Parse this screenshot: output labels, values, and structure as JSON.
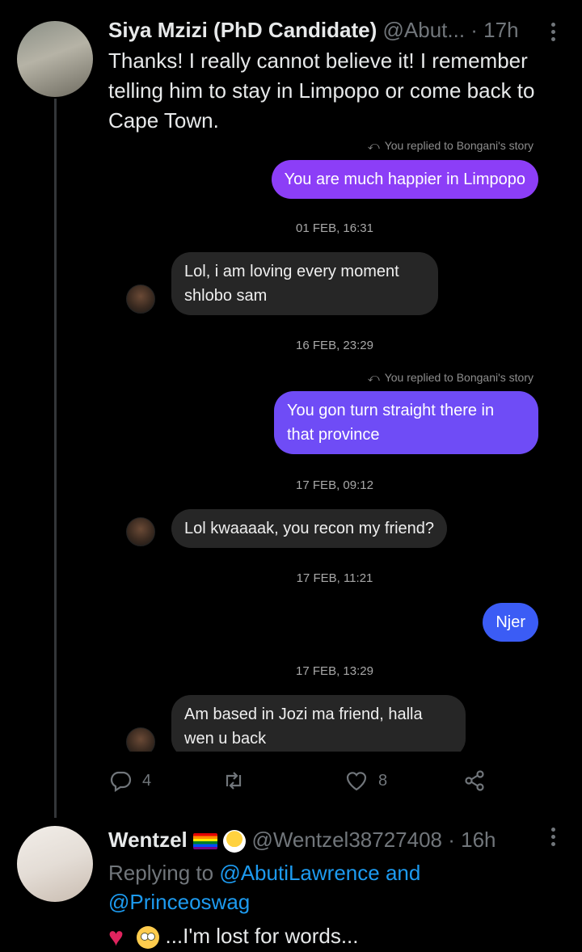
{
  "tweet1": {
    "name": "Siya Mzizi (PhD Candidate)",
    "handle": "@Abut...",
    "time": "· 17h",
    "text": "Thanks! I really cannot believe it! I remember telling him to stay in Limpopo or come back to Cape Town."
  },
  "dm": {
    "messages": [
      {
        "type": "note",
        "text": "You replied to Bongani's story"
      },
      {
        "type": "out",
        "text": "You are much happier in Limpopo",
        "color": "#8c3ef7"
      },
      {
        "type": "stamp",
        "text": "01 FEB, 16:31"
      },
      {
        "type": "in",
        "text": "Lol, i am loving every moment shlobo sam"
      },
      {
        "type": "stamp",
        "text": "16 FEB, 23:29"
      },
      {
        "type": "note",
        "text": "You replied to Bongani's story"
      },
      {
        "type": "out",
        "text": "You gon turn straight there in that province",
        "color": "#6f4cf6"
      },
      {
        "type": "stamp",
        "text": "17 FEB, 09:12"
      },
      {
        "type": "in",
        "text": "Lol kwaaaak, you recon my friend?"
      },
      {
        "type": "stamp",
        "text": "17 FEB, 11:21"
      },
      {
        "type": "out",
        "text": "Njer",
        "color": "#3b5cf5"
      },
      {
        "type": "stamp",
        "text": "17 FEB, 13:29"
      },
      {
        "type": "in",
        "text": "Am based in Jozi ma friend, halla wen u back"
      }
    ]
  },
  "actions": {
    "reply_count": "4",
    "retweet_count": "",
    "like_count": "8"
  },
  "tweet2": {
    "name": "Wentzel",
    "handle": "@Wentzel38727408",
    "time": "· 16h",
    "replying_prefix": "Replying to",
    "mention1": "@AbutiLawrence",
    "and": "and",
    "mention2": "@Princeoswag",
    "text": "...I'm lost for words..."
  },
  "icons": [
    "more-icon",
    "reply-icon",
    "retweet-icon",
    "like-icon",
    "share-icon"
  ]
}
